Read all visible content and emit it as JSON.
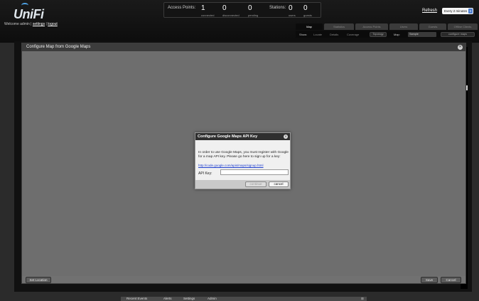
{
  "app": {
    "logo": "UniFi"
  },
  "header": {
    "welcome_text": "Welcome admin",
    "settings_link": "settings",
    "logout_link": "logout",
    "separator": "|",
    "stats": {
      "access_points_label": "Access Points:",
      "connected_value": "1",
      "connected_label": "connected",
      "disconnected_value": "0",
      "disconnected_label": "disconnected",
      "pending_value": "0",
      "pending_label": "pending",
      "stations_label": "Stations:",
      "users_value": "0",
      "users_label": "users",
      "guests_value": "0",
      "guests_label": "guests"
    },
    "refresh_label": "Refresh",
    "refresh_value": "Every 2 minutes"
  },
  "tabs": [
    {
      "label": "Map"
    },
    {
      "label": "Statistics"
    },
    {
      "label": "Access Points"
    },
    {
      "label": "Users"
    },
    {
      "label": "Guests"
    },
    {
      "label": "Offline Clients"
    }
  ],
  "toolbar": {
    "show_label": "Show:",
    "items": [
      "Locate",
      "Details",
      "Coverage"
    ],
    "topology_btn": "Topology",
    "map_label": "Map:",
    "map_value": "Sample",
    "configure_btn": "configure maps"
  },
  "config_panel": {
    "title": "Configure Map from Google Maps",
    "set_location_btn": "Set Location",
    "save_btn": "Save",
    "cancel_btn": "Cancel"
  },
  "dialog": {
    "title": "Configure Google Maps API Key",
    "body": "In order to use Google Maps, you must register with Google for a map API key. Please go here to sign up for a key:",
    "link": "http://code.google.com/apis/maps/signup.html",
    "api_label": "API Key:",
    "api_value": "",
    "continue_btn": "continue",
    "cancel_btn": "cancel"
  },
  "bottom_tabs": [
    "Recent Events",
    "Alerts",
    "Settings",
    "Admin"
  ],
  "colors": {
    "link_blue": "#1f3fcf",
    "accent_blue": "#4d7fd0",
    "panel_gray": "#717171"
  }
}
